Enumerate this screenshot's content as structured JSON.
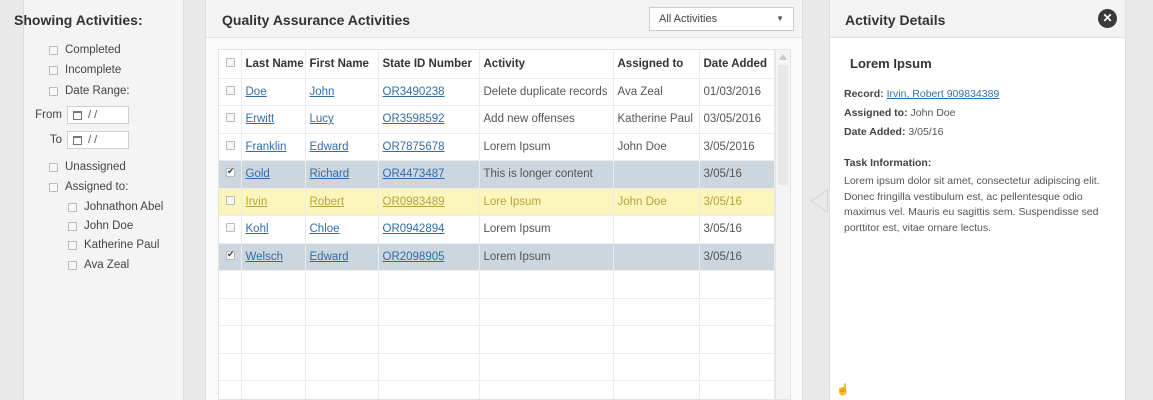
{
  "filters": {
    "title": "Showing Activities:",
    "completed": "Completed",
    "incomplete": "Incomplete",
    "date_range": "Date Range:",
    "from_label": "From",
    "to_label": "To",
    "date_placeholder": "/  /",
    "unassigned": "Unassigned",
    "assigned_to": "Assigned to:",
    "assignees": [
      "Johnathon Abel",
      "John Doe",
      "Katherine Paul",
      "Ava Zeal"
    ]
  },
  "qa": {
    "title": "Quality Assurance Activities",
    "select_value": "All Activities",
    "columns": [
      "Last Name",
      "First Name",
      "State ID Number",
      "Activity",
      "Assigned to",
      "Date Added"
    ],
    "rows": [
      {
        "last": "Doe",
        "first": "John",
        "state_id": "OR3490238",
        "activity": "Delete duplicate records",
        "assigned": "Ava Zeal",
        "date": "01/03/2016",
        "checked": false,
        "state": "normal"
      },
      {
        "last": "Erwitt",
        "first": "Lucy",
        "state_id": "OR3598592",
        "activity": "Add new offenses",
        "assigned": "Katherine Paul",
        "date": "03/05/2016",
        "checked": false,
        "state": "normal"
      },
      {
        "last": "Franklin",
        "first": "Edward",
        "state_id": "OR7875678",
        "activity": "Lorem Ipsum",
        "assigned": "John Doe",
        "date": "3/05/2016",
        "checked": false,
        "state": "normal"
      },
      {
        "last": "Gold",
        "first": "Richard",
        "state_id": "OR4473487",
        "activity": "This is longer content",
        "assigned": "",
        "date": "3/05/16",
        "checked": true,
        "state": "selected"
      },
      {
        "last": "Irvin",
        "first": "Robert",
        "state_id": "OR0983489",
        "activity": "Lore Ipsum",
        "assigned": "John Doe",
        "date": "3/05/16",
        "checked": false,
        "state": "highlighted"
      },
      {
        "last": "Kohl",
        "first": "Chloe",
        "state_id": "OR0942894",
        "activity": "Lorem Ipsum",
        "assigned": "",
        "date": "3/05/16",
        "checked": false,
        "state": "normal"
      },
      {
        "last": "Welsch",
        "first": "Edward",
        "state_id": "OR2098905",
        "activity": "Lorem Ipsum",
        "assigned": "",
        "date": "3/05/16",
        "checked": true,
        "state": "selected"
      }
    ],
    "empty_rows": 5
  },
  "details": {
    "title": "Activity Details",
    "name": "Lorem Ipsum",
    "record_label": "Record:",
    "record_value": "Irvin, Robert 909834389",
    "assigned_label": "Assigned to:",
    "assigned_value": "John Doe",
    "date_label": "Date Added:",
    "date_value": "3/05/16",
    "task_label": "Task Information:",
    "task_text": "Lorem ipsum dolor sit amet, consectetur adipiscing elit. Donec fringilla vestibulum est, ac pellentesque odio maximus vel. Mauris eu sagittis sem. Suspendisse sed porttitor est, vitae ornare lectus."
  },
  "icons": {
    "close": "close-icon",
    "calendar": "calendar-icon",
    "dropdown": "chevron-down-icon",
    "cursor": "hand-cursor-icon"
  },
  "colors": {
    "link": "#2f6ea8",
    "selected_row": "#ccd6de",
    "highlighted_row": "#fcf6bd",
    "highlighted_text": "#b7a338"
  }
}
